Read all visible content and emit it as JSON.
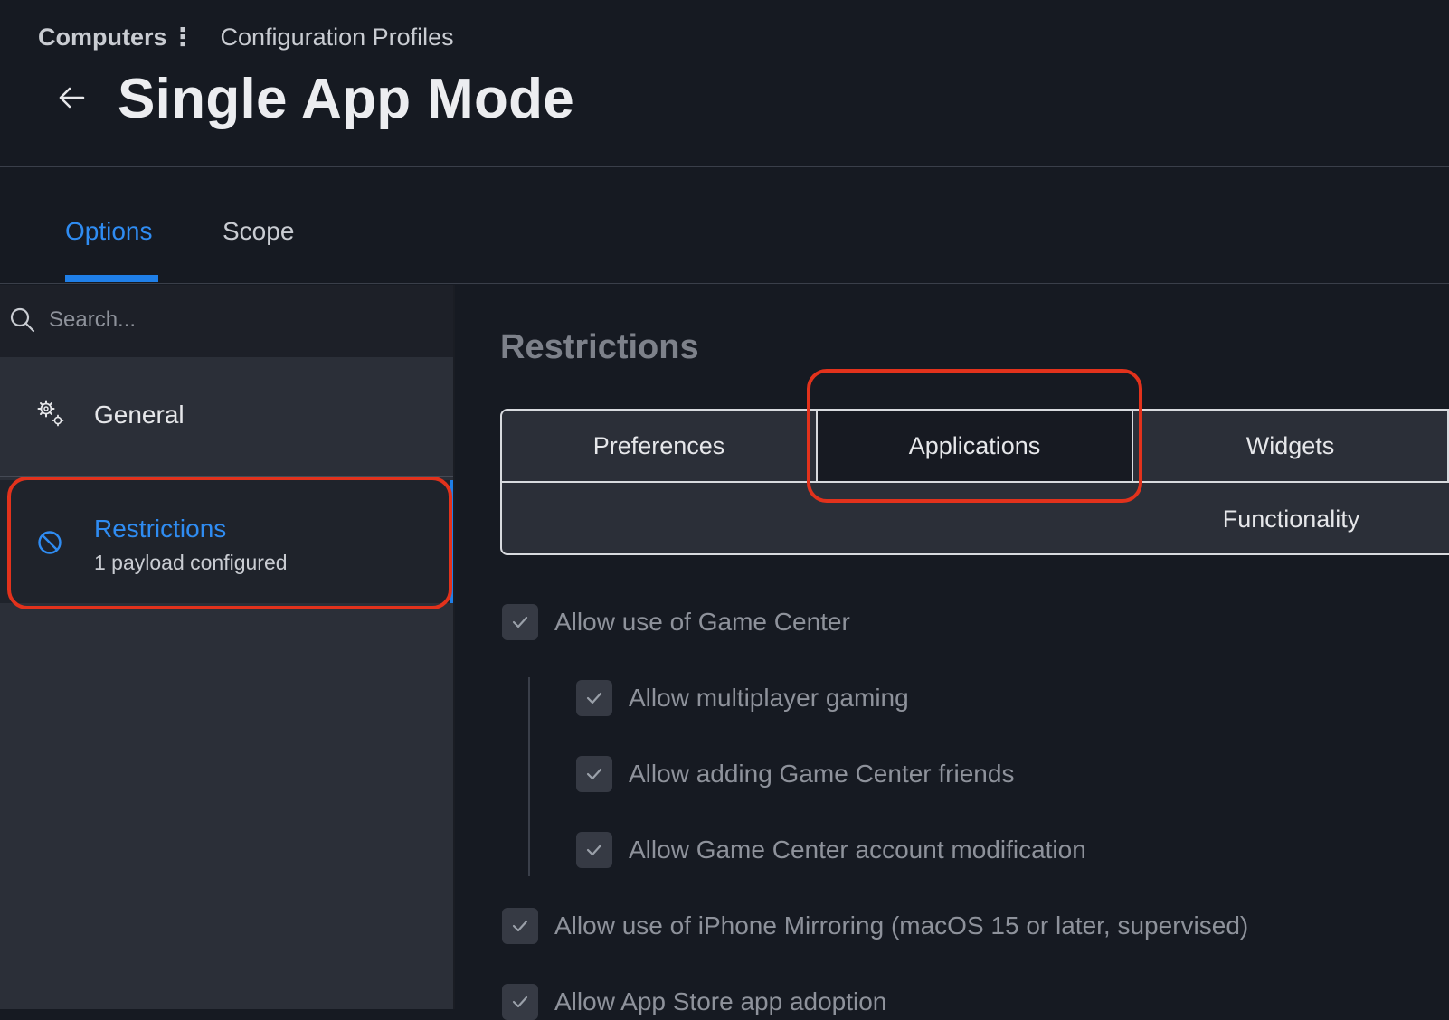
{
  "breadcrumb": {
    "root": "Computers",
    "current": "Configuration Profiles"
  },
  "page": {
    "title": "Single App Mode"
  },
  "tabs": [
    {
      "label": "Options",
      "active": true
    },
    {
      "label": "Scope",
      "active": false
    }
  ],
  "sidebar": {
    "search_placeholder": "Search...",
    "items": [
      {
        "label": "General",
        "icon": "gears-icon"
      },
      {
        "label": "Restrictions",
        "sublabel": "1 payload configured",
        "icon": "no-entry-icon",
        "selected": true
      }
    ]
  },
  "main": {
    "section_title": "Restrictions",
    "segments": [
      {
        "label": "Preferences",
        "active": false
      },
      {
        "label": "Applications",
        "active": true
      },
      {
        "label": "Widgets",
        "active": false
      },
      {
        "label": "Functionality",
        "active": false
      }
    ],
    "options": [
      {
        "label": "Allow use of Game Center",
        "checked": true,
        "level": 0
      },
      {
        "label": "Allow multiplayer gaming",
        "checked": true,
        "level": 1
      },
      {
        "label": "Allow adding Game Center friends",
        "checked": true,
        "level": 1
      },
      {
        "label": "Allow Game Center account modification",
        "checked": true,
        "level": 1
      },
      {
        "label": "Allow use of iPhone Mirroring (macOS 15 or later, supervised)",
        "checked": true,
        "level": 0
      },
      {
        "label": "Allow App Store app adoption",
        "checked": true,
        "level": 0
      }
    ]
  },
  "colors": {
    "accent": "#1f7fe8",
    "annotation": "#e2321c",
    "background": "#161a22",
    "sidebar": "#2b2f38"
  }
}
